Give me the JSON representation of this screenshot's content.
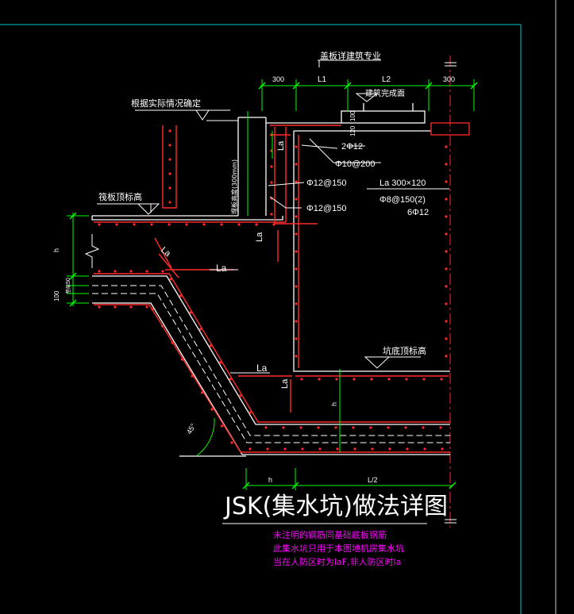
{
  "drawing": {
    "title": "JSK(集水坑)做法详图",
    "notes": [
      "未注明的钢筋同基础底板钢筋",
      "此集水坑只用于本图地机房集水坑",
      "当在人防区时为laF,非人防区时la"
    ],
    "colors": {
      "background": "#000000",
      "frame": "#00c8c8",
      "concrete": "#ffffff",
      "rebar": "#ff2a2a",
      "dimension": "#00ff00",
      "text": "#ffffff",
      "note": "#ff00ff"
    }
  },
  "labels": {
    "cover_spec": "盖板详建筑专业",
    "dim_300_left": "300",
    "dim_l1": "L1",
    "dim_l2": "L2",
    "dim_300_right": "300",
    "finish_level": "建筑完成面",
    "site_determine": "根据实际情况确定",
    "slab_top": "筏板顶标高",
    "pit_bottom": "坑底顶标高",
    "vertical_note": "埋板高度(300mm)",
    "rebar_2phi12": "2Φ12",
    "rebar_phi10": "Φ10@200",
    "rebar_phi12_a": "Φ12@150",
    "rebar_phi12_b": "Φ12@150",
    "beam_size": "La 300×120",
    "beam_stirrup": "Φ8@150(2)",
    "beam_bars": "6Φ12",
    "la_1": "La",
    "la_2": "La",
    "la_3": "La",
    "la_4": "La",
    "la_5": "La",
    "la_6": "La",
    "la_7": "La",
    "h_left": "h",
    "h_mid": "h",
    "h_bottom": "h",
    "l2_half": "L/2",
    "dim_100": "100",
    "dim_50": "50",
    "dim_s": "垫层",
    "angle": "45°",
    "small_120": "120",
    "small_100": "100"
  }
}
